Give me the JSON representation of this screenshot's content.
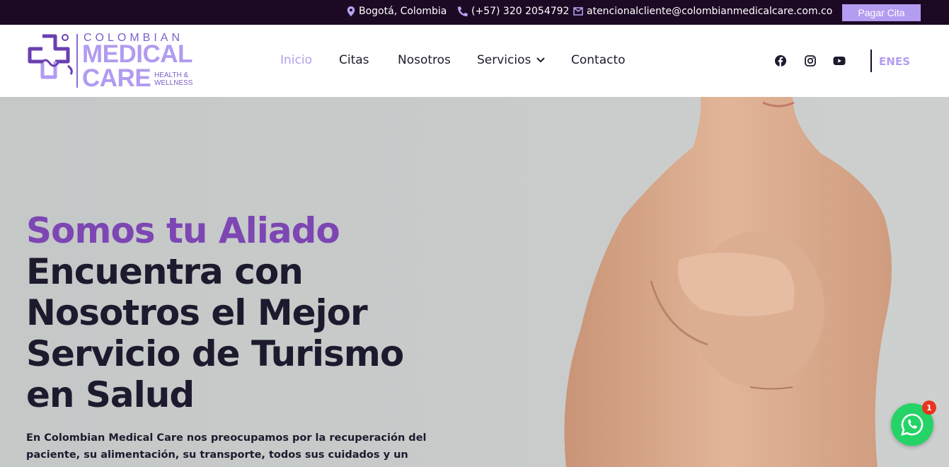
{
  "topbar": {
    "location": "Bogotá, Colombia",
    "phone": "(+57) 320 2054792",
    "email": "atencionalcliente@colombianmedicalcare.com.co",
    "pay_button": "Pagar Cita"
  },
  "logo": {
    "line1": "COLOMBIAN",
    "line2": "MEDICAL",
    "line3": "CARE",
    "tagline1": "HEALTH &",
    "tagline2": "WELLNESS"
  },
  "nav": {
    "items": [
      "Inicio",
      "Citas",
      "Nosotros",
      "Servicios",
      "Contacto"
    ],
    "active": "Inicio"
  },
  "language": {
    "en": "EN",
    "es": "ES"
  },
  "hero": {
    "headline_accent": "Somos tu Aliado",
    "headline_lines": [
      "Encuentra con",
      "Nosotros el Mejor",
      "Servicio de Turismo",
      "en Salud"
    ],
    "description": "En Colombian Medical Care nos preocupamos por la recuperación del paciente, su alimentación, su transporte, todos sus cuidados y un servicio"
  },
  "whatsapp": {
    "badge_count": "1"
  },
  "colors": {
    "accent": "#b49cf0",
    "headline_purple": "#7d46b3",
    "dark": "#1e1a2e",
    "topbar": "#1c0a25",
    "whatsapp": "#25d366"
  }
}
